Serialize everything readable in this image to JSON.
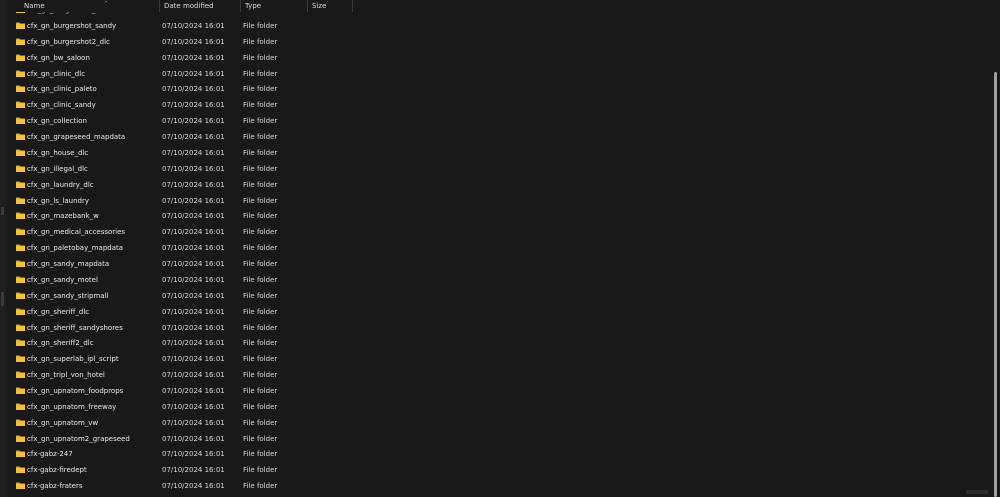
{
  "columns": {
    "name": "Name",
    "date": "Date modified",
    "type": "Type",
    "size": "Size",
    "sort_glyph": "^"
  },
  "colors": {
    "background": "#191919",
    "folder": "#f2c23a",
    "text": "#ececec",
    "divider": "#3a3a3a"
  },
  "icons": {
    "folder": "folder-icon"
  },
  "partial_row": "cfx_gn_burgershot_...",
  "files": [
    {
      "name": "cfx_gn_burgershot_sandy",
      "date": "07/10/2024 16:01",
      "type": "File folder",
      "size": ""
    },
    {
      "name": "cfx_gn_burgershot2_dlc",
      "date": "07/10/2024 16:01",
      "type": "File folder",
      "size": ""
    },
    {
      "name": "cfx_gn_bw_saloon",
      "date": "07/10/2024 16:01",
      "type": "File folder",
      "size": ""
    },
    {
      "name": "cfx_gn_clinic_dlc",
      "date": "07/10/2024 16:01",
      "type": "File folder",
      "size": ""
    },
    {
      "name": "cfx_gn_clinic_paleto",
      "date": "07/10/2024 16:01",
      "type": "File folder",
      "size": ""
    },
    {
      "name": "cfx_gn_clinic_sandy",
      "date": "07/10/2024 16:01",
      "type": "File folder",
      "size": ""
    },
    {
      "name": "cfx_gn_collection",
      "date": "07/10/2024 16:01",
      "type": "File folder",
      "size": ""
    },
    {
      "name": "cfx_gn_grapeseed_mapdata",
      "date": "07/10/2024 16:01",
      "type": "File folder",
      "size": ""
    },
    {
      "name": "cfx_gn_house_dlc",
      "date": "07/10/2024 16:01",
      "type": "File folder",
      "size": ""
    },
    {
      "name": "cfx_gn_illegal_dlc",
      "date": "07/10/2024 16:01",
      "type": "File folder",
      "size": ""
    },
    {
      "name": "cfx_gn_laundry_dlc",
      "date": "07/10/2024 16:01",
      "type": "File folder",
      "size": ""
    },
    {
      "name": "cfx_gn_ls_laundry",
      "date": "07/10/2024 16:01",
      "type": "File folder",
      "size": ""
    },
    {
      "name": "cfx_gn_mazebank_w",
      "date": "07/10/2024 16:01",
      "type": "File folder",
      "size": ""
    },
    {
      "name": "cfx_gn_medical_accessories",
      "date": "07/10/2024 16:01",
      "type": "File folder",
      "size": ""
    },
    {
      "name": "cfx_gn_paletobay_mapdata",
      "date": "07/10/2024 16:01",
      "type": "File folder",
      "size": ""
    },
    {
      "name": "cfx_gn_sandy_mapdata",
      "date": "07/10/2024 16:01",
      "type": "File folder",
      "size": ""
    },
    {
      "name": "cfx_gn_sandy_motel",
      "date": "07/10/2024 16:01",
      "type": "File folder",
      "size": ""
    },
    {
      "name": "cfx_gn_sandy_stripmall",
      "date": "07/10/2024 16:01",
      "type": "File folder",
      "size": ""
    },
    {
      "name": "cfx_gn_sheriff_dlc",
      "date": "07/10/2024 16:01",
      "type": "File folder",
      "size": ""
    },
    {
      "name": "cfx_gn_sheriff_sandyshores",
      "date": "07/10/2024 16:01",
      "type": "File folder",
      "size": ""
    },
    {
      "name": "cfx_gn_sheriff2_dlc",
      "date": "07/10/2024 16:01",
      "type": "File folder",
      "size": ""
    },
    {
      "name": "cfx_gn_superlab_ipl_script",
      "date": "07/10/2024 16:01",
      "type": "File folder",
      "size": ""
    },
    {
      "name": "cfx_gn_tripl_von_hotel",
      "date": "07/10/2024 16:01",
      "type": "File folder",
      "size": ""
    },
    {
      "name": "cfx_gn_upnatom_foodprops",
      "date": "07/10/2024 16:01",
      "type": "File folder",
      "size": ""
    },
    {
      "name": "cfx_gn_upnatom_freeway",
      "date": "07/10/2024 16:01",
      "type": "File folder",
      "size": ""
    },
    {
      "name": "cfx_gn_upnatom_vw",
      "date": "07/10/2024 16:01",
      "type": "File folder",
      "size": ""
    },
    {
      "name": "cfx_gn_upnatom2_grapeseed",
      "date": "07/10/2024 16:01",
      "type": "File folder",
      "size": ""
    },
    {
      "name": "cfx-gabz-247",
      "date": "07/10/2024 16:01",
      "type": "File folder",
      "size": ""
    },
    {
      "name": "cfx-gabz-firedept",
      "date": "07/10/2024 16:01",
      "type": "File folder",
      "size": ""
    },
    {
      "name": "cfx-gabz-fraters",
      "date": "07/10/2024 16:01",
      "type": "File folder",
      "size": ""
    }
  ]
}
